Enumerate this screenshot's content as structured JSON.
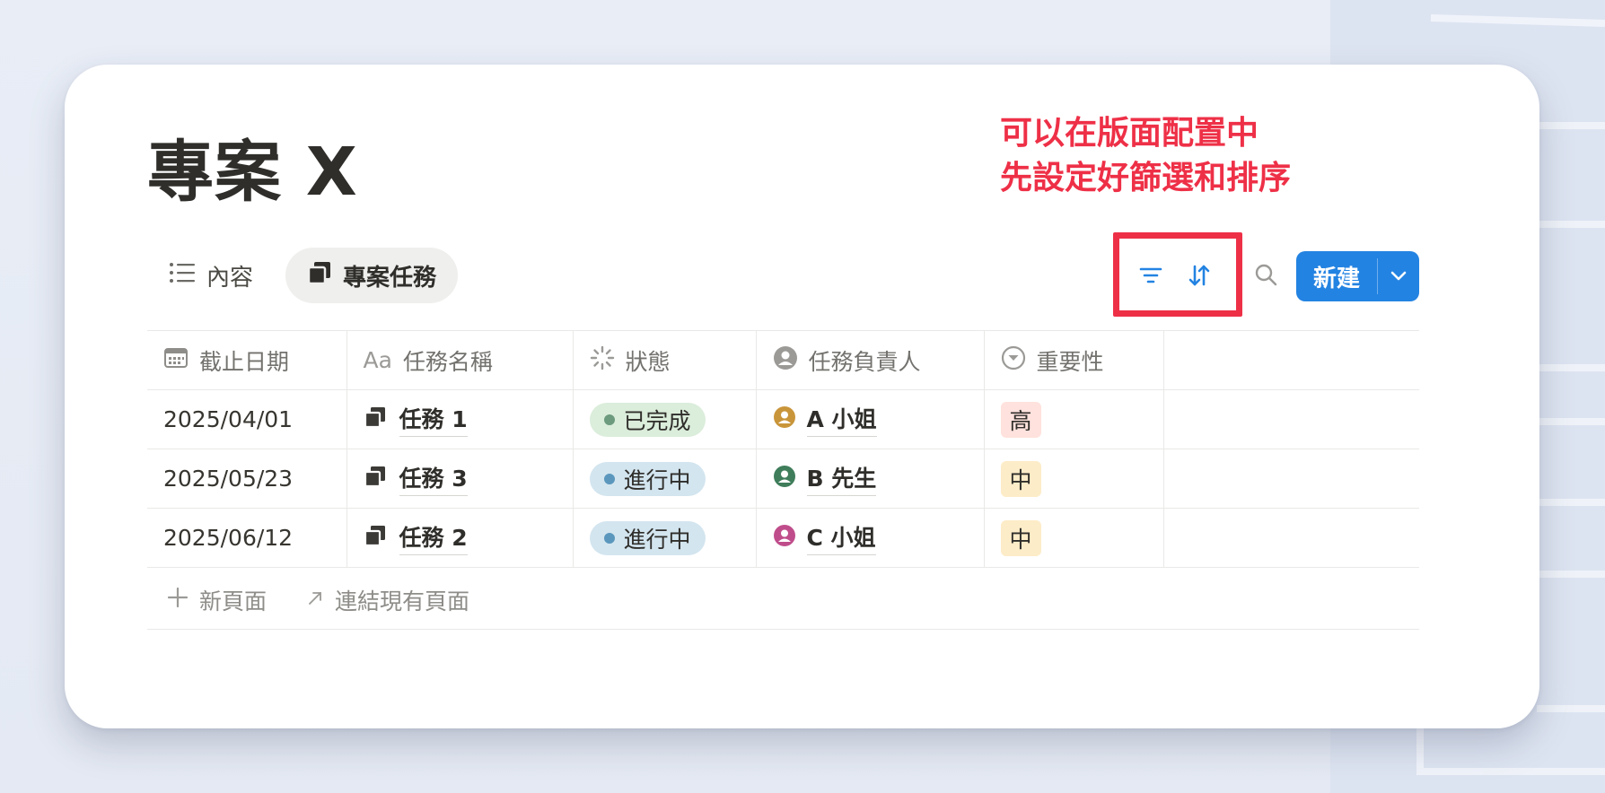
{
  "page": {
    "title": "專案 X"
  },
  "annotation": {
    "line1": "可以在版面配置中",
    "line2": "先設定好篩選和排序",
    "color": "#ee3047"
  },
  "views": [
    {
      "label": "內容",
      "icon": "list-icon",
      "active": false
    },
    {
      "label": "專案任務",
      "icon": "task-stack-icon",
      "active": true
    }
  ],
  "toolbar": {
    "filter_icon": "filter-icon",
    "sort_icon": "sort-icon",
    "search_icon": "search-icon",
    "new_label": "新建",
    "accent": "#2383e2"
  },
  "table": {
    "columns": [
      {
        "label": "截止日期",
        "icon": "calendar-icon"
      },
      {
        "label": "任務名稱",
        "icon": "text-aa-icon",
        "icon_text": "Aa"
      },
      {
        "label": "狀態",
        "icon": "status-spinner-icon"
      },
      {
        "label": "任務負責人",
        "icon": "person-icon"
      },
      {
        "label": "重要性",
        "icon": "select-icon"
      }
    ],
    "rows": [
      {
        "date": "2025/04/01",
        "task": "任務 1",
        "status": "已完成",
        "owner": "A 小姐",
        "priority": "高"
      },
      {
        "date": "2025/05/23",
        "task": "任務 3",
        "status": "進行中",
        "owner": "B 先生",
        "priority": "中"
      },
      {
        "date": "2025/06/12",
        "task": "任務 2",
        "status": "進行中",
        "owner": "C 小姐",
        "priority": "中"
      }
    ]
  },
  "footer": {
    "new_page": "新頁面",
    "link_existing": "連結現有頁面"
  },
  "colors": {
    "status_done_bg": "#dbeddb",
    "status_done_dot": "#6c9b7d",
    "status_progress_bg": "#d3e5ef",
    "status_progress_dot": "#5b97bd",
    "priority_high_bg": "#ffe2dd",
    "priority_mid_bg": "#fdecc8",
    "avatar_a": "#c9953a",
    "avatar_b": "#3f7d5b",
    "avatar_c": "#c04d8b"
  }
}
